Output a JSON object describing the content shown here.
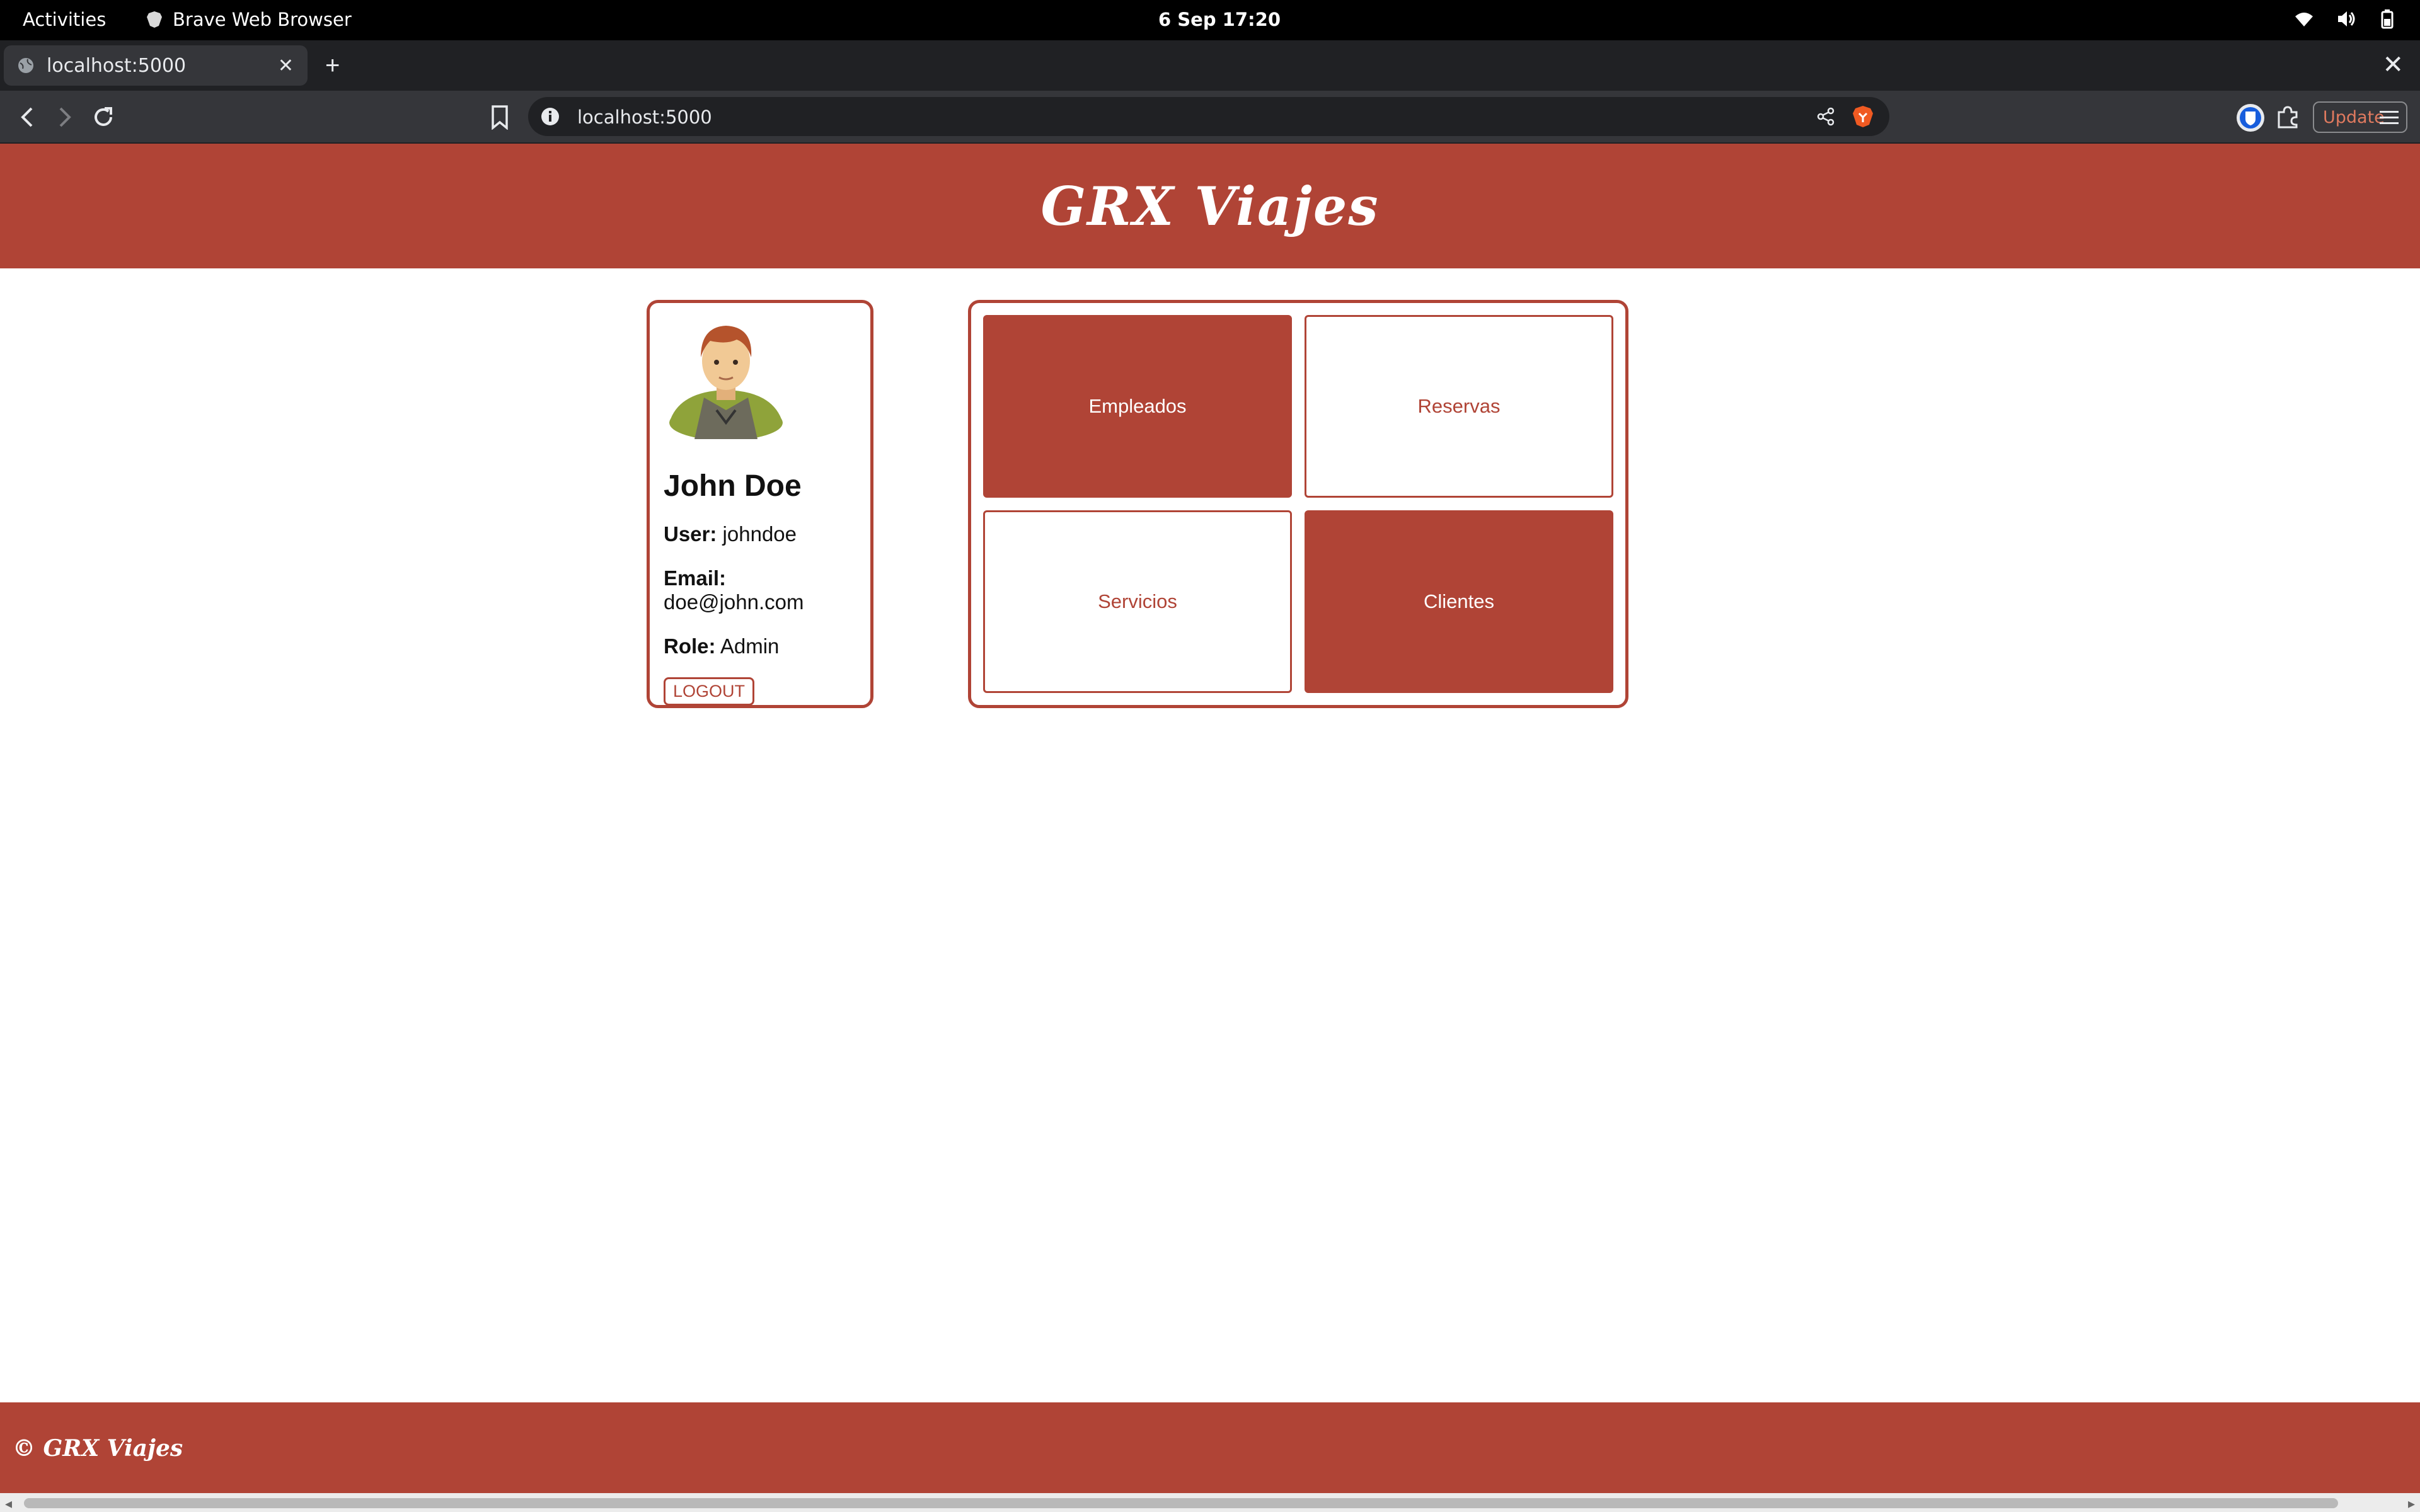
{
  "system_bar": {
    "activities": "Activities",
    "app_name": "Brave Web Browser",
    "clock": "6 Sep  17:20"
  },
  "browser": {
    "tab_title": "localhost:5000",
    "new_tab": "+",
    "window_close": "✕",
    "tab_close": "✕",
    "url": "localhost:5000",
    "update_label": "Update"
  },
  "site": {
    "title": "GRX Viajes",
    "footer_copyright": "© GRX Viajes"
  },
  "profile": {
    "name": "John Doe",
    "user_label": "User:",
    "user_value": "johndoe",
    "email_label": "Email:",
    "email_value": "doe@john.com",
    "role_label": "Role:",
    "role_value": "Admin",
    "logout_label": "LOGOUT"
  },
  "menu": {
    "tiles": [
      {
        "label": "Empleados",
        "style": "filled"
      },
      {
        "label": "Reservas",
        "style": "outline"
      },
      {
        "label": "Servicios",
        "style": "outline"
      },
      {
        "label": "Clientes",
        "style": "filled"
      }
    ]
  },
  "colors": {
    "brand": "#b04436"
  }
}
